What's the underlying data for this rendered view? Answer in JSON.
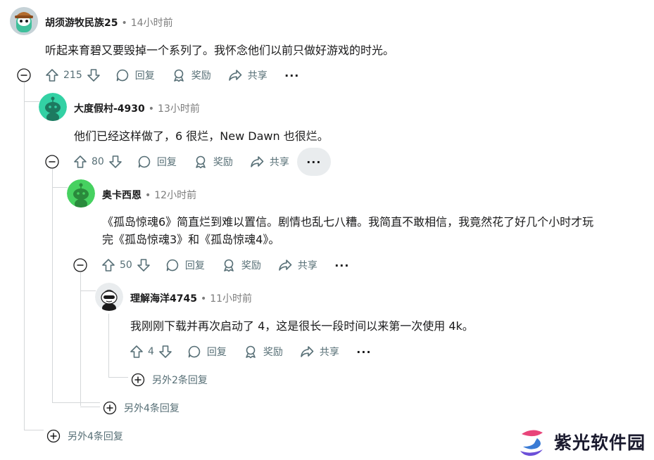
{
  "comments": [
    {
      "username": "胡须游牧民族25",
      "time": "14小时前",
      "text": "听起来育碧又要毁掉一个系列了。我怀念他们以前只做好游戏的时光。",
      "votes": "215",
      "reply_label": "回复",
      "award_label": "奖励",
      "share_label": "共享",
      "more_label": "···"
    },
    {
      "username": "大度假村-4930",
      "time": "13小时前",
      "text": "他们已经这样做了，6 很烂，New Dawn 也很烂。",
      "votes": "80",
      "reply_label": "回复",
      "award_label": "奖励",
      "share_label": "共享",
      "more_label": "···"
    },
    {
      "username": "奥卡西恩",
      "time": "12小时前",
      "text_line1": "《孤岛惊魂6》简直烂到难以置信。剧情也乱七八糟。我简直不敢相信，我竟然花了好几个小时才玩",
      "text_line2": "完《孤岛惊魂3》和《孤岛惊魂4》。",
      "votes": "50",
      "reply_label": "回复",
      "award_label": "奖励",
      "share_label": "共享",
      "more_label": "···"
    },
    {
      "username": "理解海洋4745",
      "time": "11小时前",
      "text": "我刚刚下载并再次启动了 4，这是很长一段时间以来第一次使用 4k。",
      "votes": "4",
      "reply_label": "回复",
      "award_label": "奖励",
      "share_label": "共享",
      "more_label": "···"
    }
  ],
  "more_replies": [
    "另外2条回复",
    "另外4条回复",
    "另外4条回复"
  ],
  "watermark": "紫光软件园",
  "colors": {
    "thread_line": "#d4d7d9",
    "meta_text": "#576f76",
    "avatar_green": "#46d160",
    "avatar_teal": "#33d1a4"
  }
}
